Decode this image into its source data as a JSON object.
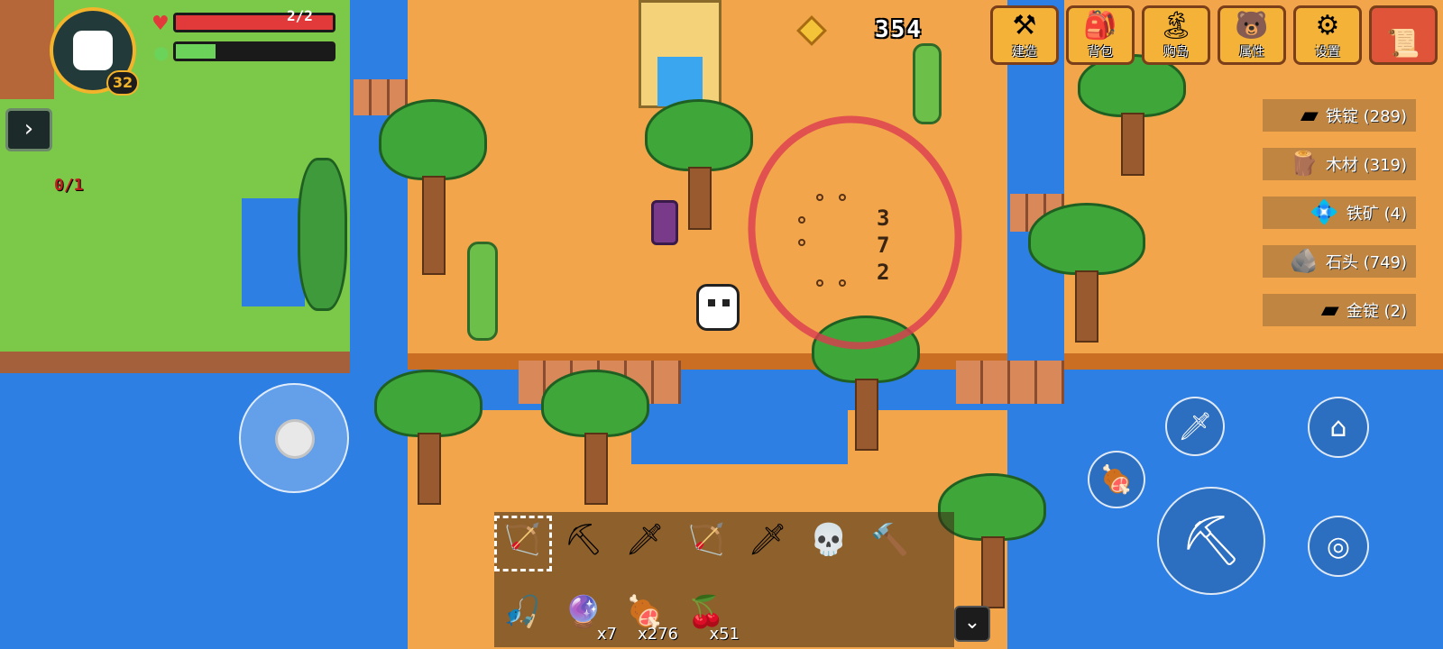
{
  "hud": {
    "level": "32",
    "hp_text": "2/2",
    "hp_fill": 1.0,
    "energy_fill": 0.25,
    "quest_text": "0/1",
    "coin_count": "354"
  },
  "menu": [
    {
      "label": "建造",
      "icon": "anvil-icon",
      "glyph": "⚒"
    },
    {
      "label": "背包",
      "icon": "backpack-icon",
      "glyph": "🎒"
    },
    {
      "label": "购岛",
      "icon": "island-icon",
      "glyph": "🏝"
    },
    {
      "label": "属性",
      "icon": "stats-icon",
      "glyph": "🐻"
    },
    {
      "label": "设置",
      "icon": "gear-icon",
      "glyph": "⚙"
    },
    {
      "label": "",
      "icon": "map-scroll-icon",
      "glyph": "📜"
    }
  ],
  "resources": [
    {
      "label": "铁锭 (289)",
      "icon": "iron-ingot-icon",
      "glyph": "▰"
    },
    {
      "label": "木材 (319)",
      "icon": "wood-icon",
      "glyph": "🪵"
    },
    {
      "label": "铁矿 (4)",
      "icon": "iron-ore-icon",
      "glyph": "💠"
    },
    {
      "label": "石头 (749)",
      "icon": "stone-icon",
      "glyph": "🪨"
    },
    {
      "label": "金锭 (2)",
      "icon": "gold-ingot-icon",
      "glyph": "▰"
    }
  ],
  "timer_digits": [
    "3",
    "7",
    "2"
  ],
  "hotbar": {
    "top": [
      {
        "icon": "crossbow-icon",
        "glyph": "🏹"
      },
      {
        "icon": "shovel-icon",
        "glyph": "⛏"
      },
      {
        "icon": "sword-icon",
        "glyph": "🗡"
      },
      {
        "icon": "bow-icon",
        "glyph": "🏹"
      },
      {
        "icon": "golden-sword-icon",
        "glyph": "🗡"
      },
      {
        "icon": "skull-staff-icon",
        "glyph": "💀"
      },
      {
        "icon": "hammer-icon",
        "glyph": "🔨"
      }
    ],
    "bottom": [
      {
        "icon": "fishing-rod-icon",
        "glyph": "🎣",
        "count": ""
      },
      {
        "icon": "orb-icon",
        "glyph": "🔮",
        "count": "x7"
      },
      {
        "icon": "meat-icon",
        "glyph": "🍖",
        "count": "x276"
      },
      {
        "icon": "berries-icon",
        "glyph": "🍒",
        "count": "x51"
      }
    ]
  },
  "colors": {
    "water": "#2e7fe4",
    "sand": "#f2a54a",
    "grass": "#7cc94a",
    "hp": "#e23a3a",
    "energy": "#6cd35a",
    "annotation": "#dc3c50"
  }
}
